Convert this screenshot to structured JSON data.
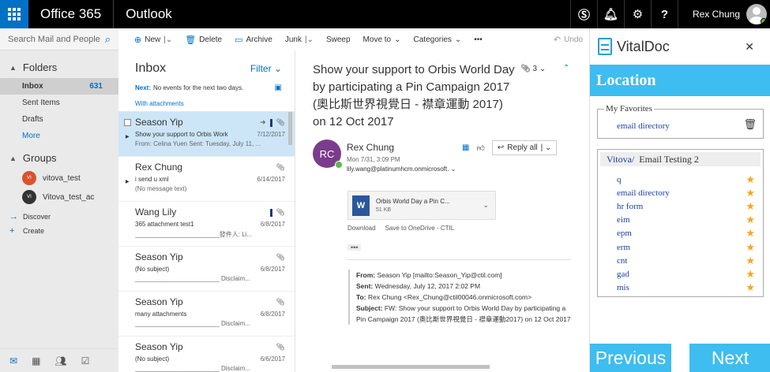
{
  "topbar": {
    "brand": "Office 365",
    "app": "Outlook",
    "user": "Rex Chung"
  },
  "search": {
    "placeholder": "Search Mail and People"
  },
  "folders": {
    "section": "Folders",
    "items": [
      {
        "label": "Inbox",
        "count": "631"
      },
      {
        "label": "Sent Items",
        "count": ""
      },
      {
        "label": "Drafts",
        "count": ""
      },
      {
        "label": "More",
        "count": ""
      }
    ]
  },
  "groups": {
    "section": "Groups",
    "items": [
      {
        "label": "vitova_test",
        "initials": "VI",
        "color": "#d9532c"
      },
      {
        "label": "Vitova_test_ac",
        "initials": "VI",
        "color": "#333333"
      }
    ]
  },
  "nav_links": [
    {
      "label": "Discover",
      "icon": "arrow-right-icon"
    },
    {
      "label": "Create",
      "icon": "plus-icon"
    }
  ],
  "toolbar": {
    "new": "New",
    "delete": "Delete",
    "archive": "Archive",
    "junk": "Junk",
    "sweep": "Sweep",
    "moveto": "Move to",
    "categories": "Categories",
    "more": "•••",
    "undo": "Undo"
  },
  "list": {
    "title": "Inbox",
    "filter": "Filter",
    "next_label": "Next:",
    "next_text": "No events for the next two days.",
    "group": "With attachments",
    "messages": [
      {
        "sender": "Season Yip",
        "subject": "Show your support to Orbis Work",
        "date": "7/12/2017",
        "preview": "From: Celina Yuen Sent: Tuesday, July 11, ..."
      },
      {
        "sender": "Rex Chung",
        "subject": "i send u xml",
        "date": "6/14/2017",
        "preview": "(No message text)"
      },
      {
        "sender": "Wang Lily",
        "subject": "365 attachment test1",
        "date": "6/8/2017",
        "preview": "________________________發件人: Li..."
      },
      {
        "sender": "Season Yip",
        "subject": "(No subject)",
        "date": "6/8/2017",
        "preview": "________________________ Disclaim..."
      },
      {
        "sender": "Season Yip",
        "subject": "many attachments",
        "date": "6/8/2017",
        "preview": "________________________ Disclaim..."
      },
      {
        "sender": "Season Yip",
        "subject": "(No subject)",
        "date": "6/6/2017",
        "preview": "________________________ Disclaim..."
      }
    ]
  },
  "reading": {
    "subject": "Show your support to Orbis World Day by participating a Pin Campaign 2017 (奧比斯世界視覺日 - 襟章運動 2017) on 12 Oct 2017",
    "attachment_count": "3",
    "avatar_initials": "RC",
    "sender": "Rex Chung",
    "date": "Mon 7/31, 3:09 PM",
    "to": "lily.wang@platinumhcm.onmicrosoft.",
    "reply_all": "Reply all",
    "attachment_name": "Orbis World Day a Pin C...",
    "attachment_size": "51 KB",
    "download": "Download",
    "save_onedrive": "Save to OneDrive - CTIL",
    "fwd_from_label": "From:",
    "fwd_from": "Season Yip [mailto:Season_Yip@ctil.com]",
    "fwd_sent_label": "Sent:",
    "fwd_sent": "Wednesday, July 12, 2017 2:02 PM",
    "fwd_to_label": "To:",
    "fwd_to": "Rex Chung <Rex_Chung@ctil00046.onmicrosoft.com>",
    "fwd_subject_label": "Subject:",
    "fwd_subject": "FW: Show your support to Orbis World Day by participating a Pin Campaign 2017 (奧比斯世界視覺日 - 襟章運動2017) on 12 Oct 2017"
  },
  "vitaldoc": {
    "title": "VitalDoc",
    "location": "Location",
    "favorites_legend": "My Favorites",
    "favorite": "email directory",
    "path_root": "Vitova/",
    "path_current": "Email Testing 2",
    "folders": [
      "q",
      "email directory",
      "hr form",
      "eim",
      "epm",
      "erm",
      "cnt",
      "gad",
      "mis"
    ],
    "previous": "Previous",
    "next": "Next"
  },
  "colors": {
    "accent": "#0072c6",
    "vital_blue": "#3dbdf0",
    "selected_row": "#cde6f7"
  }
}
